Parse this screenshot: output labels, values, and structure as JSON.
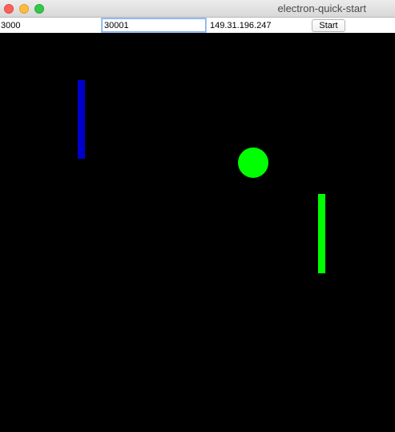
{
  "window": {
    "title": "electron-quick-start"
  },
  "toolbar": {
    "local_port_value": "3000",
    "remote_port_value": "30001",
    "remote_ip_value": "149.31.196.247",
    "start_label": "Start"
  },
  "colors": {
    "left_paddle": "#0000cc",
    "right_paddle": "#00ff00",
    "ball": "#00ff00",
    "game_background": "#000000"
  }
}
